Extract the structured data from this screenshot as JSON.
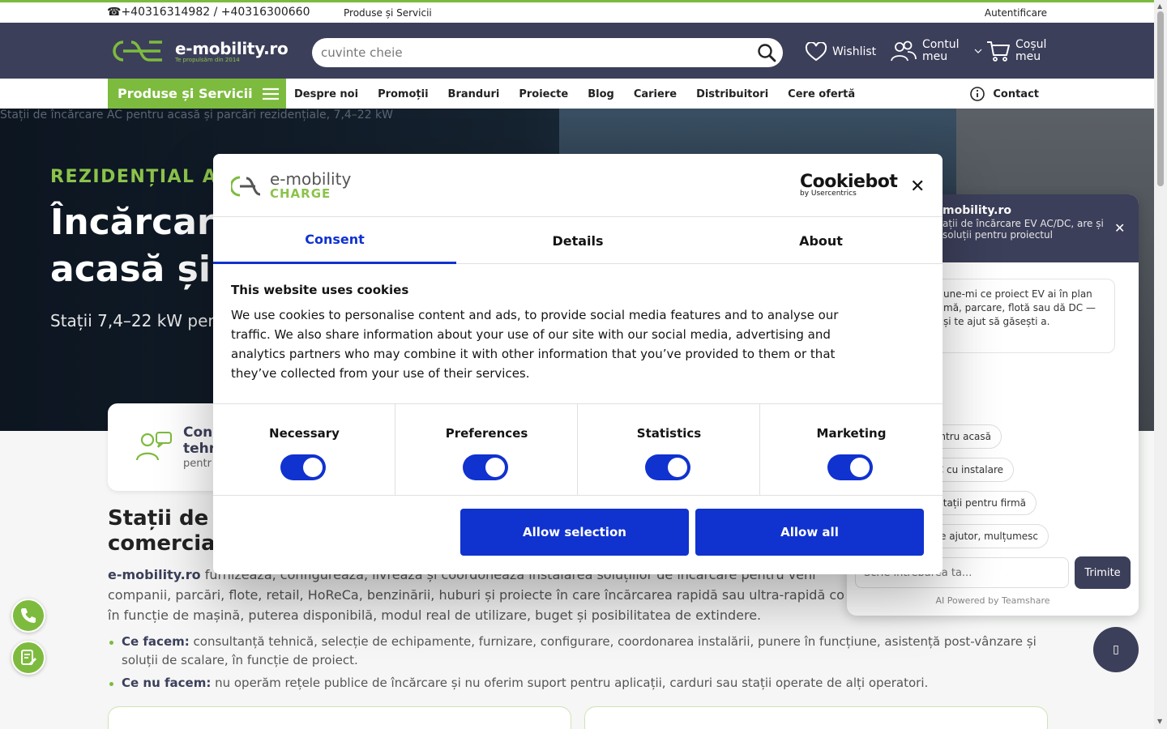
{
  "topbar": {
    "phone": "☎+40316314982 / +40316300660",
    "products": "Produse și Servicii",
    "login": "Autentificare"
  },
  "header": {
    "brand": "e-mobility.ro",
    "tagline": "Te propulsăm din 2014",
    "search_placeholder": "cuvinte cheie",
    "wishlist": "Wishlist",
    "account": "Contul meu",
    "cart": "Coșul meu"
  },
  "nav": {
    "products": "Produse și Servicii",
    "links": [
      "Despre noi",
      "Promoții",
      "Branduri",
      "Proiecte",
      "Blog",
      "Cariere",
      "Distribuitori",
      "Cere ofertă"
    ],
    "contact": "Contact"
  },
  "hero": {
    "alt": "Stații de încărcare AC pentru acasă și parcări rezidențiale, 7,4–22 kW",
    "kicker": "REZIDENȚIAL AC",
    "title_1": "Încărcare",
    "title_2": "acasă și",
    "subtitle": "Stații 7,4–22 kW pent"
  },
  "card": {
    "title_1": "Con",
    "title_2": "tehr",
    "subtitle": "pentr"
  },
  "main": {
    "h2_1": "Stații de",
    "h2_2": "comercia",
    "para_brand": "e-mobility.ro",
    "para_1": " furnizează, configurează, livrează și coordonează instalarea soluțiilor de încărcare pentru vehi",
    "para_2": "companii, parcări, flote, retail, HoReCa, benzinării, huburi și proiecte în care încărcarea rapidă sau ultra-rapidă co",
    "para_3": "în funcție de mașină, puterea disponibilă, modul real de utilizare, buget și posibilitatea de extindere.",
    "bullet1_label": "Ce facem:",
    "bullet1_text": " consultanță tehnică, selecție de echipamente, furnizare, configurare, coordonarea instalării, punere în funcțiune, asistență post-vânzare și soluții de scalare, în funcție de proiect.",
    "bullet2_label": "Ce nu facem:",
    "bullet2_text": " nu operăm rețele publice de încărcare și nu oferim suport pentru aplicații, carduri sau stații operate de alți operatori."
  },
  "chat": {
    "name": "mobility.ro",
    "desc": "ații de încărcare EV AC/DC, are și soluții pentru proiectul",
    "close": "✕",
    "message": "une-mi ce proiect EV ai în plan mă, parcare, flotă sau dă DC — și te ajut să găsești a.",
    "suggestions": [
      "ntru acasă",
      "C cu instalare",
      "stații pentru firmă",
      "e ajutor, mulțumesc"
    ],
    "input_placeholder": "Scrie întrebarea ta...",
    "send": "Trimite",
    "powered": "AI Powered by Teamshare",
    "fab_glyph": "▯"
  },
  "cookie": {
    "logo_line1": "e-mobility",
    "logo_line2": "CHARGE",
    "cookiebot": "Cookiebot",
    "cookiebot_by": "by Usercentrics",
    "close": "✕",
    "tabs": [
      "Consent",
      "Details",
      "About"
    ],
    "title": "This website uses cookies",
    "text": "We use cookies to personalise content and ads, to provide social media features and to analyse our traffic. We also share information about your use of our site with our social media, advertising and analytics partners who may combine it with other information that you’ve provided to them or that they’ve collected from your use of their services.",
    "categories": [
      "Necessary",
      "Preferences",
      "Statistics",
      "Marketing"
    ],
    "allow_selection": "Allow selection",
    "allow_all": "Allow all"
  },
  "colors": {
    "accent_green": "#7dbb3e",
    "header_navy": "#3c3f5a",
    "cookie_blue": "#1032cf"
  }
}
